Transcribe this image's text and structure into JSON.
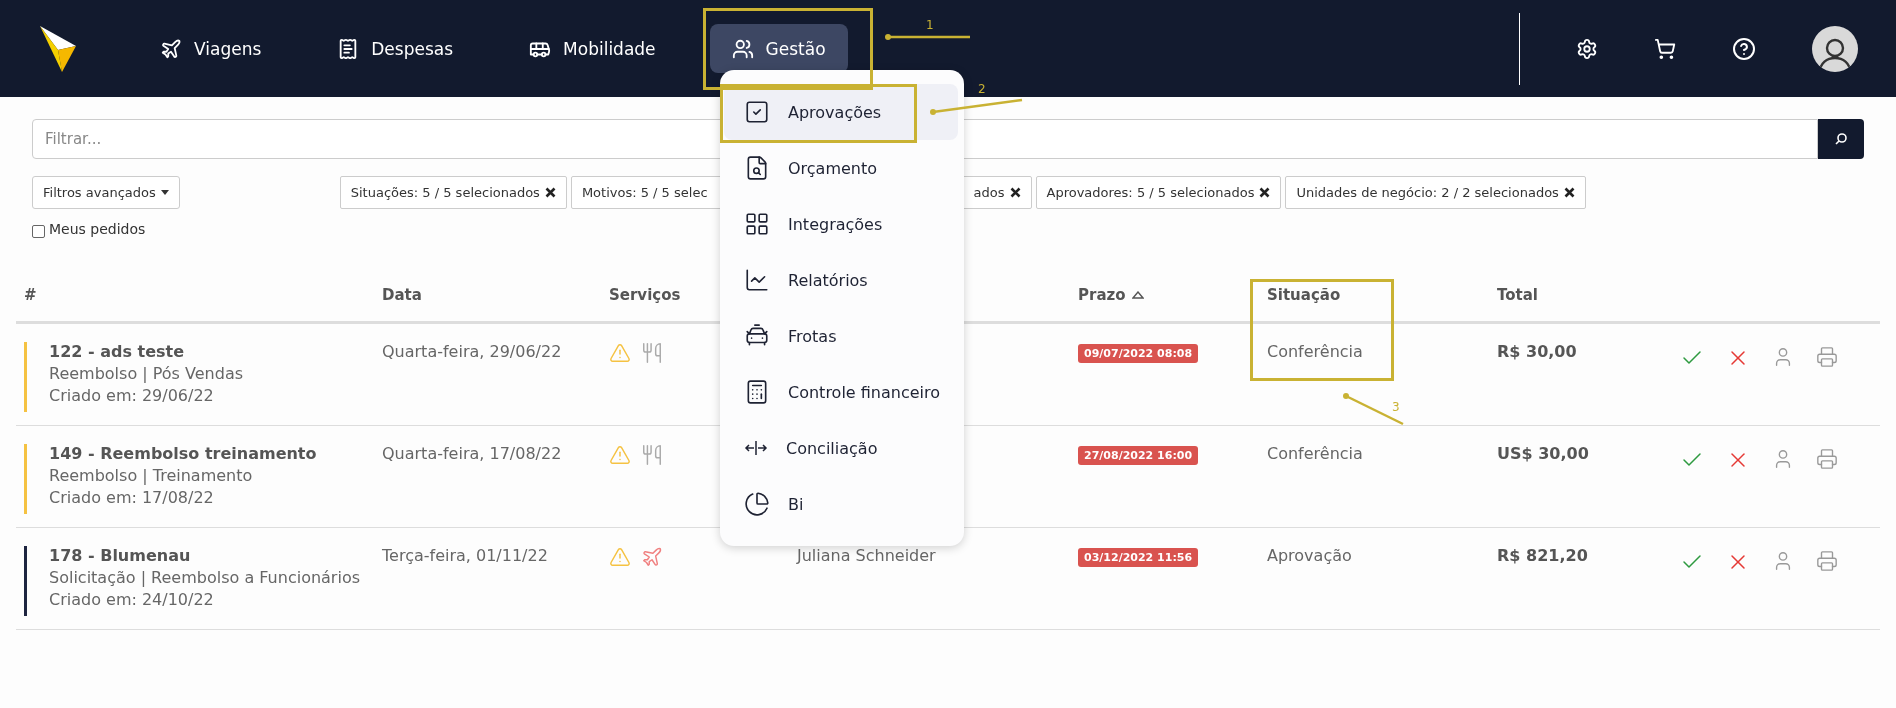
{
  "nav": {
    "items": [
      {
        "label": "Viagens",
        "selected": false
      },
      {
        "label": "Despesas",
        "selected": false
      },
      {
        "label": "Mobilidade",
        "selected": false
      },
      {
        "label": "Gestão",
        "selected": true
      }
    ]
  },
  "menu": {
    "items": [
      {
        "label": "Aprovações",
        "selected": true
      },
      {
        "label": "Orçamento",
        "selected": false
      },
      {
        "label": "Integrações",
        "selected": false
      },
      {
        "label": "Relatórios",
        "selected": false
      },
      {
        "label": "Frotas",
        "selected": false
      },
      {
        "label": "Controle financeiro",
        "selected": false
      },
      {
        "label": "Conciliação",
        "selected": false
      },
      {
        "label": "Bi",
        "selected": false
      }
    ]
  },
  "filter": {
    "placeholder": "Filtrar..."
  },
  "advanced_filters": "Filtros avançados",
  "chips": [
    {
      "label": "Situações: 5 / 5 selecionados",
      "kind": "full"
    },
    {
      "label": "Motivos: 5 / 5 selec",
      "kind": "cut_right"
    },
    {
      "label": "ados",
      "kind": "cut_left"
    },
    {
      "label": "Aprovadores: 5 / 5 selecionados",
      "kind": "full"
    },
    {
      "label": "Unidades de negócio: 2 / 2 selecionados",
      "kind": "full"
    }
  ],
  "my_requests": {
    "label": "Meus pedidos",
    "checked": false
  },
  "table": {
    "columns": [
      "#",
      "Data",
      "Serviços",
      "Prazo",
      "Situação",
      "Total"
    ],
    "rows": [
      {
        "title": "122 - ads teste",
        "type": "Reembolso | Pós Vendas",
        "created": "Criado em: 29/06/22",
        "color": "#f5c242",
        "date": "Quarta-feira, 29/06/22",
        "services": [
          {
            "kind": "warning"
          },
          {
            "kind": "meal"
          }
        ],
        "deadline": "09/07/2022 08:08",
        "status": "Conferência",
        "total": "R$ 30,00"
      },
      {
        "title": "149 - Reembolso treinamento",
        "type": "Reembolso | Treinamento",
        "created": "Criado em: 17/08/22",
        "color": "#f5c242",
        "date": "Quarta-feira, 17/08/22",
        "services": [
          {
            "kind": "warning"
          },
          {
            "kind": "meal"
          }
        ],
        "deadline": "27/08/2022 16:00",
        "status": "Conferência",
        "total": "US$ 30,00"
      },
      {
        "title": "178 - Blumenau",
        "type": "Solicitação | Reembolso a Funcionários",
        "created": "Criado em: 24/10/22",
        "color": "#1e2540",
        "date": "Terça-feira, 01/11/22",
        "services": [
          {
            "kind": "warning"
          },
          {
            "kind": "flight"
          }
        ],
        "requester": "Juliana Schneider",
        "deadline": "03/12/2022 11:56",
        "status": "Aprovação",
        "total": "R$ 821,20"
      }
    ]
  },
  "annotations": [
    {
      "number": "1"
    },
    {
      "number": "2"
    },
    {
      "number": "3"
    }
  ]
}
